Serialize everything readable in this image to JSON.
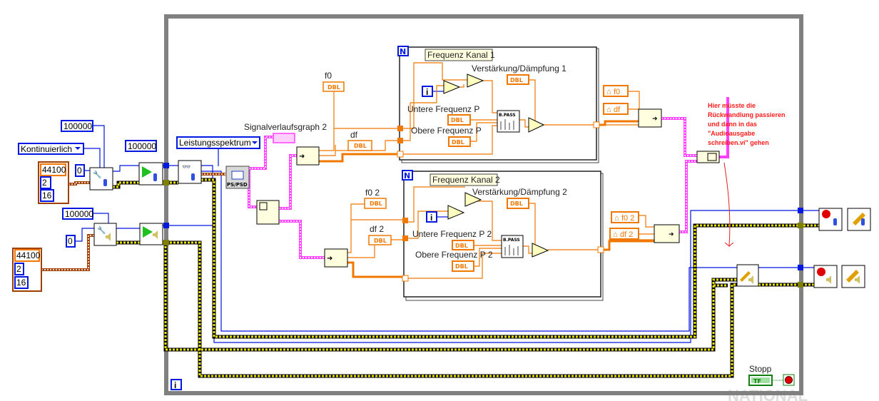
{
  "colors": {
    "error_wire": "#0018e0",
    "task_wire": "#d8d000",
    "dbl_wire": "#f07800",
    "waveform_wire": "#ff40ff",
    "cluster_wire": "#a04000",
    "loop_border": "#808080",
    "note": "#ff1a1a"
  },
  "input_consts": {
    "buffer1": "100000",
    "mode": "Kontinuierlich",
    "cluster1": [
      "44100",
      "2",
      "16"
    ],
    "device1": "0",
    "samples1": "100000",
    "buffer2": "100000",
    "device2": "0",
    "cluster2": [
      "44100",
      "2",
      "16"
    ]
  },
  "spectrum": {
    "mode": "Leistungsspektrum",
    "psd_label": "PS/PSD",
    "graph_label": "Signalverlaufsgraph 2"
  },
  "indicators": {
    "f0": "f0",
    "df": "df",
    "f0_2": "f0 2",
    "df_2": "df 2",
    "dbl": "DBL"
  },
  "loop1": {
    "n": "N",
    "title": "Frequenz Kanal 1",
    "gain": "Verstärkung/Dämpfung 1",
    "lower": "Untere Frequenz P",
    "upper": "Obere Frequenz P",
    "bpass": "B.PASS",
    "i": "i"
  },
  "loop2": {
    "n": "N",
    "title": "Frequenz Kanal 2",
    "gain": "Verstärkung/Dämpfung 2",
    "lower": "Untere Frequenz P 2",
    "upper": "Obere Frequenz P 2",
    "bpass": "B.PASS",
    "i": "i"
  },
  "locals": {
    "f0": "f0",
    "df": "df",
    "f0_2": "f0 2",
    "df_2": "df 2"
  },
  "note": [
    "Hier müsste die",
    "Rückwandlung passieren",
    "und dann in das",
    "\"Audioausgabe",
    "schreiben.vi\" gehen"
  ],
  "while_loop": {
    "i": "i",
    "stop_label": "Stopp",
    "stop_const": "TF"
  },
  "watermark": "NATIONAL"
}
